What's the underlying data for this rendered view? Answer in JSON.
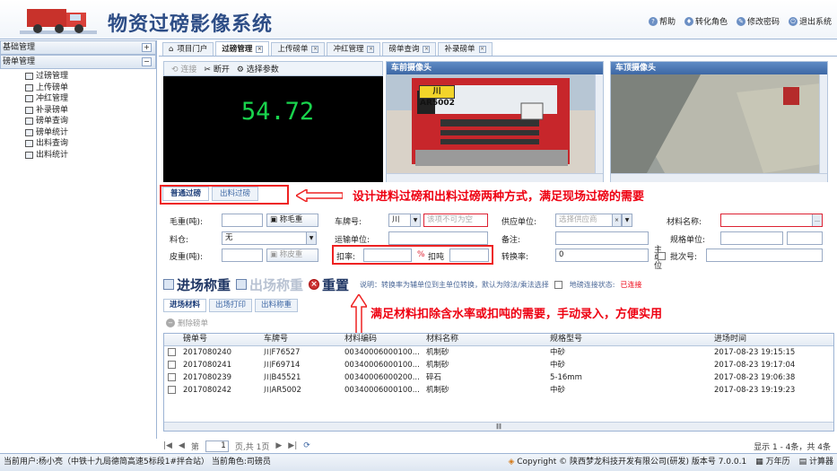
{
  "app": {
    "title": "物资过磅影像系统",
    "top_links": [
      {
        "icon": "help-icon",
        "label": "帮助"
      },
      {
        "icon": "switch-role-icon",
        "label": "转化角色"
      },
      {
        "icon": "change-password-icon",
        "label": "修改密码"
      },
      {
        "icon": "logout-icon",
        "label": "退出系统"
      }
    ]
  },
  "sidebar": {
    "section1": "基础管理",
    "section2": "磅单管理",
    "items": [
      "过磅管理",
      "上传磅单",
      "冲红管理",
      "补录磅单",
      "磅单查询",
      "磅单统计",
      "出料查询",
      "出料统计"
    ]
  },
  "tabs": [
    {
      "label": "项目门户",
      "icon": "home-icon"
    },
    {
      "label": "过磅管理",
      "active": true
    },
    {
      "label": "上传磅单"
    },
    {
      "label": "冲红管理"
    },
    {
      "label": "磅单查询"
    },
    {
      "label": "补录磅单"
    }
  ],
  "camera": {
    "connect": "连接",
    "disconnect": "断开",
    "select_params": "选择参数",
    "weight": "54.72",
    "front_title": "车前摄像头",
    "rear_title": "车顶摄像头",
    "plate": "川AR5002"
  },
  "form": {
    "tab_in": "普通过磅",
    "tab_out": "出料过磅",
    "gross_label": "毛重(吨):",
    "gross_btn": "称毛重",
    "plate_label": "车牌号:",
    "plate_prefix": "川",
    "plate_ph": "该项不可为空",
    "supplier_label": "供应单位:",
    "supplier_ph": "选择供应商",
    "material_label": "材料名称:",
    "bin_label": "料仓:",
    "bin_value": "无",
    "transport_label": "运输单位:",
    "remark_label": "备注:",
    "spec_label": "规格单位:",
    "tare_label": "皮重(吨):",
    "tare_btn": "称皮重",
    "deduct_label": "扣率:",
    "deduct_unit": "%",
    "deduct_ton": "扣吨",
    "conv_label": "转换率:",
    "conv_value": "0",
    "main_unit": "主单位",
    "batch_label": "批次号:"
  },
  "actions": {
    "enter": "进场称重",
    "exit": "出场称重",
    "reset": "重置",
    "note": "说明：转换率为辅单位到主单位转换，默认为除法/乘法选择",
    "scale_status_label": "地磅连接状态:",
    "scale_status": "已连接"
  },
  "annotations": {
    "top": "设计进料过磅和出料过磅两种方式，满足现场过磅的需要",
    "bottom": "满足材料扣除含水率或扣吨的需要，手动录入，方便实用"
  },
  "lower_tabs": [
    "进场材料",
    "出场打印",
    "出料称重"
  ],
  "grid_tool": "删除磅单",
  "grid": {
    "headers": [
      "",
      "磅单号",
      "车牌号",
      "材料编码",
      "材料名称",
      "规格型号",
      "进场时间"
    ],
    "rows": [
      [
        "2017080240",
        "川F76527",
        "00340006000100...",
        "机制砂",
        "中砂",
        "2017-08-23 19:15:15"
      ],
      [
        "2017080241",
        "川F69714",
        "00340006000100...",
        "机制砂",
        "中砂",
        "2017-08-23 19:17:04"
      ],
      [
        "2017080239",
        "川B45521",
        "00340006000200...",
        "碎石",
        "5-16mm",
        "2017-08-23 19:06:38"
      ],
      [
        "2017080242",
        "川AR5002",
        "00340006000100...",
        "机制砂",
        "中砂",
        "2017-08-23 19:19:23"
      ]
    ]
  },
  "pager": {
    "page_prefix": "第",
    "page": "1",
    "page_suffix": "页,共 1页",
    "stat": "显示 1 - 4条，共 4条"
  },
  "status": {
    "user": "当前用户:杨小亮（中铁十九局德简高速5标段1#拌合站） 当前角色:司磅员",
    "copyright": "Copyright © 陕西梦龙科技开发有限公司(研发) 版本号 7.0.0.1",
    "calendar": "万年历",
    "calculator": "计算器"
  }
}
